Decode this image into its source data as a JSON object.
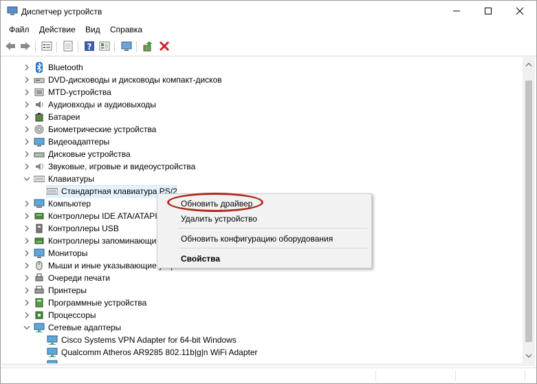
{
  "window": {
    "title": "Диспетчер устройств"
  },
  "menu": [
    "Файл",
    "Действие",
    "Вид",
    "Справка"
  ],
  "toolbar_icons": [
    "back-arrow",
    "forward-arrow",
    "properties-list",
    "show-hidden",
    "help",
    "view",
    "scan-monitor",
    "update-driver",
    "uninstall-device"
  ],
  "tree": [
    {
      "label": "Bluetooth",
      "icon": "bluetooth-icon",
      "expanded": false
    },
    {
      "label": "DVD-дисководы и дисководы компакт-дисков",
      "icon": "dvd-drive-icon",
      "expanded": false
    },
    {
      "label": "MTD-устройства",
      "icon": "mtd-device-icon",
      "expanded": false
    },
    {
      "label": "Аудиовходы и аудиовыходы",
      "icon": "speaker-icon",
      "expanded": false
    },
    {
      "label": "Батареи",
      "icon": "battery-icon",
      "expanded": false
    },
    {
      "label": "Биометрические устройства",
      "icon": "fingerprint-icon",
      "expanded": false
    },
    {
      "label": "Видеоадаптеры",
      "icon": "display-adapter-icon",
      "expanded": false
    },
    {
      "label": "Дисковые устройства",
      "icon": "disk-drive-icon",
      "expanded": false
    },
    {
      "label": "Звуковые, игровые и видеоустройства",
      "icon": "sound-icon",
      "expanded": false
    },
    {
      "label": "Клавиатуры",
      "icon": "keyboard-icon",
      "expanded": true
    },
    {
      "label": "Стандартная клавиатура PS/2",
      "icon": "keyboard-icon",
      "child": true,
      "selected": true
    },
    {
      "label": "Компьютер",
      "icon": "computer-icon",
      "expanded": false
    },
    {
      "label": "Контроллеры IDE ATA/ATAPI",
      "icon": "ide-controller-icon",
      "expanded": false
    },
    {
      "label": "Контроллеры USB",
      "icon": "usb-icon",
      "expanded": false
    },
    {
      "label": "Контроллеры запоминающих устройств",
      "icon": "storage-controller-icon",
      "expanded": false
    },
    {
      "label": "Мониторы",
      "icon": "monitor-icon",
      "expanded": false
    },
    {
      "label": "Мыши и иные указывающие устройства",
      "icon": "mouse-icon",
      "expanded": false
    },
    {
      "label": "Очереди печати",
      "icon": "print-queue-icon",
      "expanded": false
    },
    {
      "label": "Принтеры",
      "icon": "printer-icon",
      "expanded": false
    },
    {
      "label": "Программные устройства",
      "icon": "software-device-icon",
      "expanded": false
    },
    {
      "label": "Процессоры",
      "icon": "processor-icon",
      "expanded": false
    },
    {
      "label": "Сетевые адаптеры",
      "icon": "network-adapter-icon",
      "expanded": true
    },
    {
      "label": "Cisco Systems VPN Adapter for 64-bit Windows",
      "icon": "network-adapter-icon",
      "child": true
    },
    {
      "label": "Qualcomm Atheros AR9285 802.11b|g|n WiFi Adapter",
      "icon": "network-adapter-icon",
      "child": true
    },
    {
      "label": "",
      "icon": "network-adapter-icon",
      "child": true
    }
  ],
  "context_menu": {
    "update_driver": "Обновить драйвер",
    "uninstall": "Удалить устройство",
    "scan_hardware": "Обновить конфигурацию оборудования",
    "properties": "Свойства"
  },
  "colors": {
    "highlight": "#b02a1e",
    "selection": "#e5f3ff",
    "menu_bg": "#f2f2f2"
  }
}
